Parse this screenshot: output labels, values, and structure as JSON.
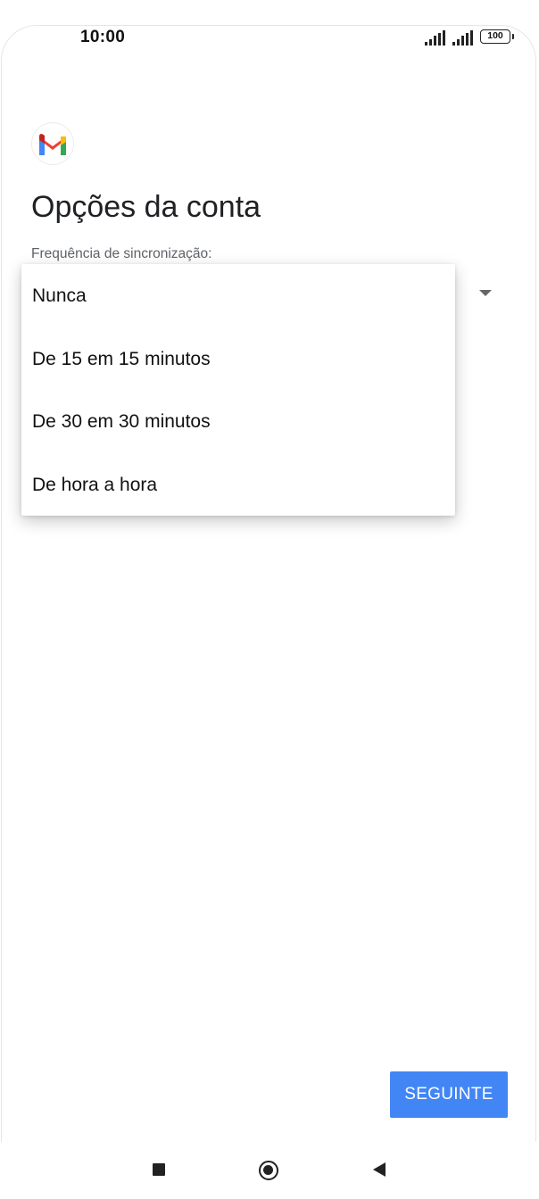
{
  "status_bar": {
    "time": "10:00",
    "battery_level": "100"
  },
  "screen": {
    "title": "Opções da conta",
    "sync_label": "Frequência de sincronização:"
  },
  "dropdown": {
    "options": [
      {
        "label": "Nunca"
      },
      {
        "label": "De 15 em 15 minutos"
      },
      {
        "label": "De 30 em 30 minutos"
      },
      {
        "label": "De hora a hora"
      }
    ]
  },
  "footer": {
    "next_label": "SEGUINTE"
  },
  "colors": {
    "accent": "#4285f4",
    "gmail_red": "#ea4335",
    "gmail_blue": "#4285f4",
    "gmail_green": "#34a853",
    "gmail_yellow": "#fbbc04",
    "gmail_dark_red": "#c5221f"
  },
  "icons": {
    "signal_1": "cell-signal-icon",
    "signal_2": "cell-signal-icon",
    "battery": "battery-icon",
    "app": "gmail-logo-icon",
    "dropdown": "dropdown-arrow-icon",
    "nav_recent": "recent-apps-icon",
    "nav_home": "home-icon",
    "nav_back": "back-icon"
  }
}
